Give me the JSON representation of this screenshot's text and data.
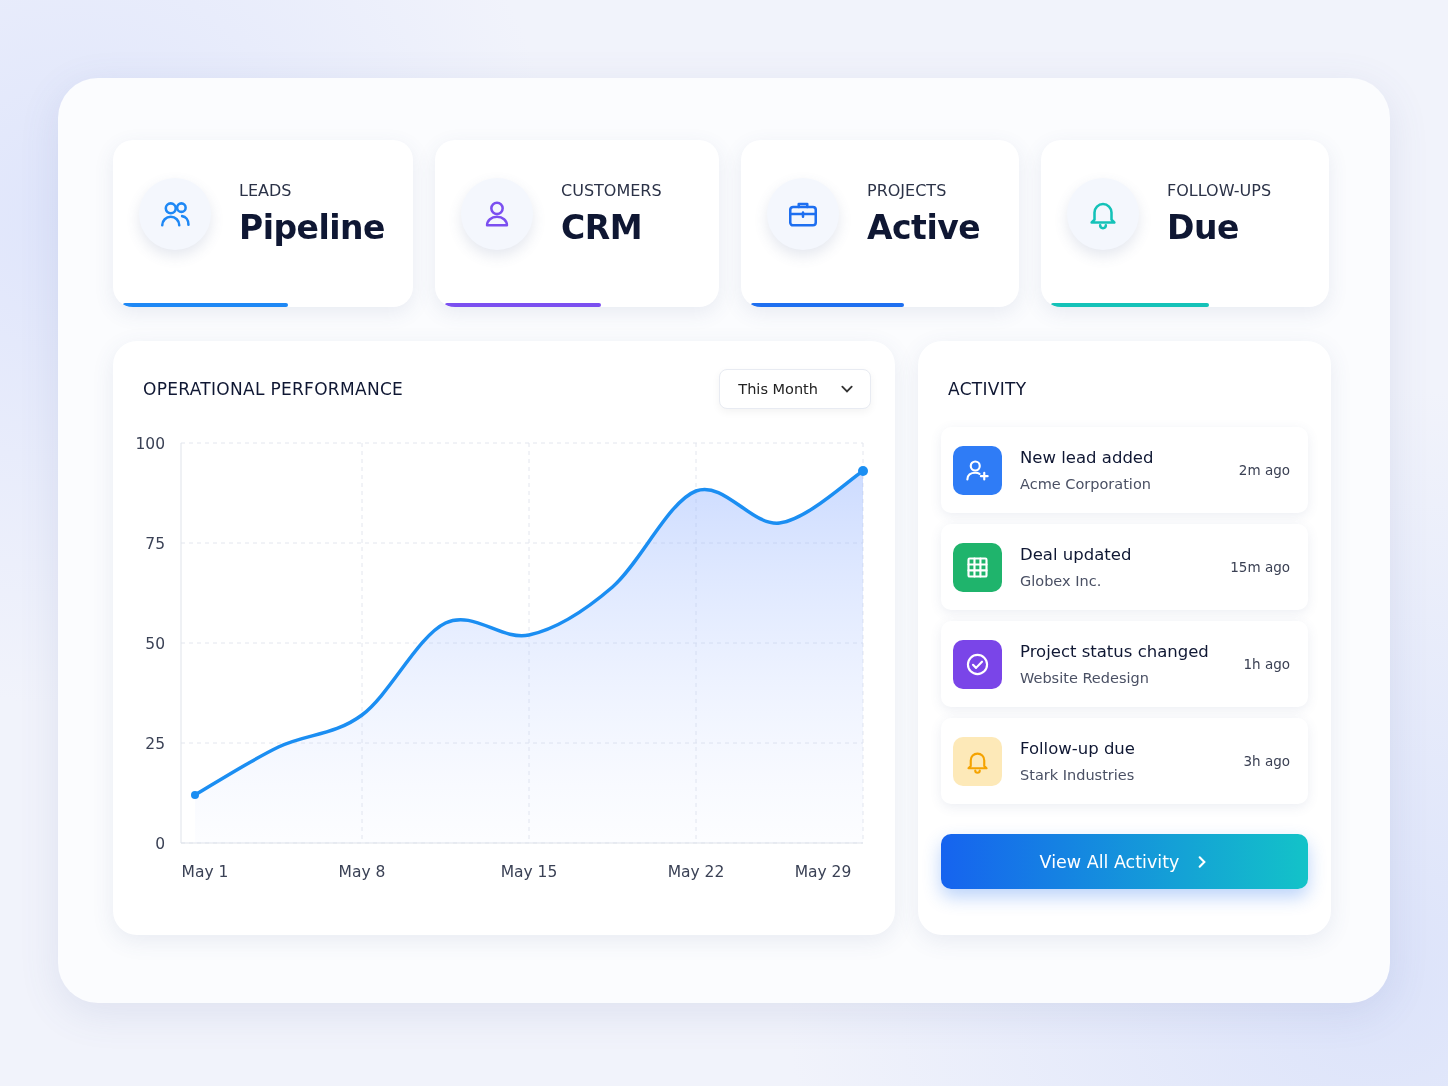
{
  "stats": [
    {
      "kind": "users",
      "label": "LEADS",
      "value": "Pipeline",
      "color": "#1e88f5"
    },
    {
      "kind": "user",
      "label": "CUSTOMERS",
      "value": "CRM",
      "color": "#7b4ff0"
    },
    {
      "kind": "briefcase",
      "label": "PROJECTS",
      "value": "Active",
      "color": "#1e6ff0"
    },
    {
      "kind": "bell",
      "label": "FOLLOW-UPS",
      "value": "Due",
      "color": "#14c2b8"
    }
  ],
  "performance": {
    "title": "OPERATIONAL PERFORMANCE",
    "period": "This Month",
    "chart_data": {
      "type": "area",
      "categories": [
        "May 1",
        null,
        "May 8",
        null,
        "May 15",
        null,
        "May 22",
        null,
        "May 29"
      ],
      "series": [
        {
          "color": "#1b8ef2",
          "values": [
            12,
            24,
            32,
            55,
            52,
            64,
            88,
            80,
            93
          ]
        }
      ],
      "ylim": [
        0,
        100
      ],
      "yticks": [
        0,
        25,
        50,
        75,
        100
      ],
      "grid": true
    }
  },
  "activity": {
    "title": "ACTIVITY",
    "items": [
      {
        "kind": "lead",
        "title": "New lead added",
        "subtitle": "Acme Corporation",
        "time": "2m ago",
        "color": "#2f7cf6"
      },
      {
        "kind": "deal",
        "title": "Deal updated",
        "subtitle": "Globex Inc.",
        "time": "15m ago",
        "color": "#1fb46c"
      },
      {
        "kind": "project",
        "title": "Project status changed",
        "subtitle": "Website Redesign",
        "time": "1h ago",
        "color": "#7a45e8"
      },
      {
        "kind": "followup",
        "title": "Follow-up due",
        "subtitle": "Stark Industries",
        "time": "3h ago",
        "color": "#fde9b8"
      }
    ],
    "button": "View All Activity"
  }
}
